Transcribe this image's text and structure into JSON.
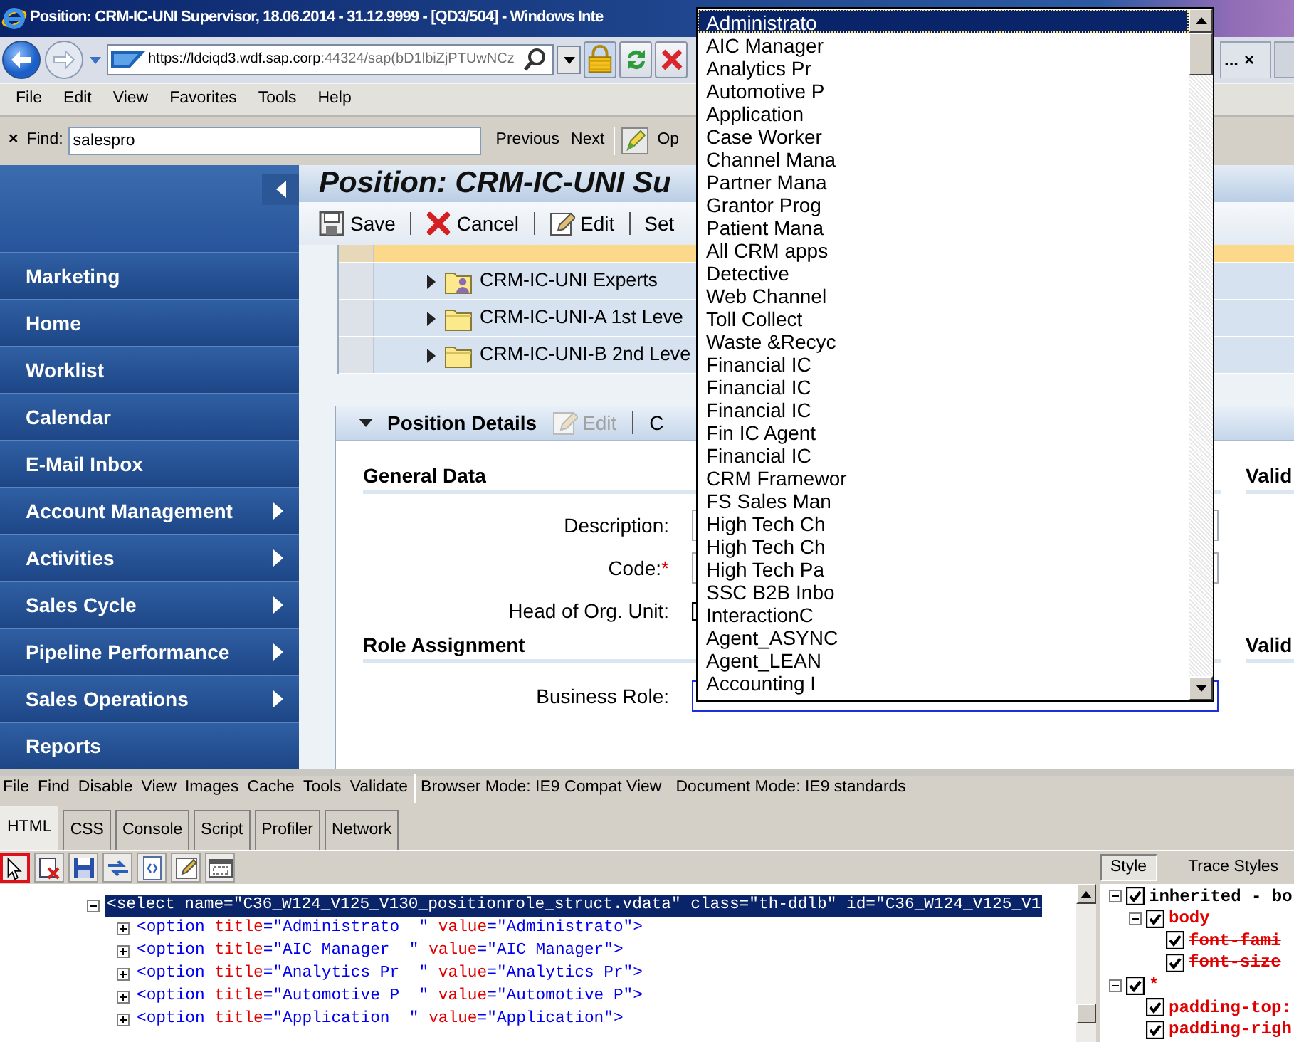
{
  "window": {
    "title": "Position: CRM-IC-UNI Supervisor, 18.06.2014 - 31.12.9999 - [QD3/504] - Windows Inte"
  },
  "address_bar": {
    "host": "https://ldciqd3.wdf.sap.corp",
    "path": ":44324/sap(bD1lbiZjPTUwNCz",
    "tab": {
      "label": "...",
      "close": "×"
    }
  },
  "menu": [
    "File",
    "Edit",
    "View",
    "Favorites",
    "Tools",
    "Help"
  ],
  "find_bar": {
    "close": "×",
    "label": "Find:",
    "value": "salespro",
    "buttons": [
      "Previous",
      "Next"
    ],
    "options": "Op"
  },
  "sidebar": {
    "items": [
      {
        "label": "Marketing",
        "submenu": false
      },
      {
        "label": "Home",
        "submenu": false
      },
      {
        "label": "Worklist",
        "submenu": false
      },
      {
        "label": "Calendar",
        "submenu": false
      },
      {
        "label": "E-Mail Inbox",
        "submenu": false
      },
      {
        "label": "Account Management",
        "submenu": true
      },
      {
        "label": "Activities",
        "submenu": true
      },
      {
        "label": "Sales Cycle",
        "submenu": true
      },
      {
        "label": "Pipeline Performance",
        "submenu": true
      },
      {
        "label": "Sales Operations",
        "submenu": true
      },
      {
        "label": "Reports",
        "submenu": false
      }
    ]
  },
  "page": {
    "title": "Position: CRM-IC-UNI Su",
    "toolbar": [
      {
        "kind": "save",
        "label": "Save"
      },
      {
        "kind": "cancel",
        "label": "Cancel"
      },
      {
        "kind": "edit",
        "label": "Edit"
      },
      {
        "kind": "plain",
        "label": "Set"
      }
    ]
  },
  "tree": {
    "rows": [
      {
        "selected": true
      },
      {
        "label": "CRM-IC-UNI Experts",
        "kind": "group",
        "selected": false
      },
      {
        "label": "CRM-IC-UNI-A 1st Leve",
        "kind": "folder",
        "selected": false
      },
      {
        "label": "CRM-IC-UNI-B 2nd Leve",
        "kind": "folder",
        "selected": false
      }
    ]
  },
  "details": {
    "title": "Position Details",
    "expanded": true,
    "actions": [
      {
        "label": "Edit",
        "disabled": true
      },
      {
        "label": "C",
        "disabled": false
      }
    ],
    "sections": [
      {
        "title": "General Data",
        "side_title": "Valid",
        "fields": [
          {
            "label": "Description:",
            "kind": "text"
          },
          {
            "label": "Code:",
            "kind": "text",
            "marker": "*"
          },
          {
            "label": "Head of Org. Unit:",
            "kind": "checkbox",
            "checked": false
          }
        ]
      },
      {
        "title": "Role Assignment",
        "side_title": "Valid",
        "fields": [
          {
            "label": "Business Role:",
            "kind": "select"
          }
        ]
      }
    ]
  },
  "dropdown": {
    "options": [
      {
        "label": "Administrato",
        "selected": true
      },
      {
        "label": "AIC Manager",
        "selected": false
      },
      {
        "label": "Analytics Pr",
        "selected": false
      },
      {
        "label": "Automotive P",
        "selected": false
      },
      {
        "label": "Application",
        "selected": false
      },
      {
        "label": "Case Worker",
        "selected": false
      },
      {
        "label": "Channel Mana",
        "selected": false
      },
      {
        "label": "Partner Mana",
        "selected": false
      },
      {
        "label": "Grantor Prog",
        "selected": false
      },
      {
        "label": "Patient Mana",
        "selected": false
      },
      {
        "label": "All CRM apps",
        "selected": false
      },
      {
        "label": "Detective",
        "selected": false
      },
      {
        "label": "Web Channel",
        "selected": false
      },
      {
        "label": "Toll Collect",
        "selected": false
      },
      {
        "label": "Waste &Recyc",
        "selected": false
      },
      {
        "label": "Financial IC",
        "selected": false
      },
      {
        "label": "Financial IC",
        "selected": false
      },
      {
        "label": "Financial IC",
        "selected": false
      },
      {
        "label": "Fin IC Agent",
        "selected": false
      },
      {
        "label": "Financial IC",
        "selected": false
      },
      {
        "label": "CRM Framewor",
        "selected": false
      },
      {
        "label": "FS Sales Man",
        "selected": false
      },
      {
        "label": "High Tech Ch",
        "selected": false
      },
      {
        "label": "High Tech Ch",
        "selected": false
      },
      {
        "label": "High Tech Pa",
        "selected": false
      },
      {
        "label": "SSC B2B Inbo",
        "selected": false
      },
      {
        "label": "InteractionC",
        "selected": false
      },
      {
        "label": "Agent_ASYNC",
        "selected": false
      },
      {
        "label": "Agent_LEAN",
        "selected": false
      },
      {
        "label": "Accounting I",
        "selected": false
      }
    ]
  },
  "devtools": {
    "menu": [
      "File",
      "Find",
      "Disable",
      "View",
      "Images",
      "Cache",
      "Tools",
      "Validate"
    ],
    "modes": [
      "Browser Mode: IE9 Compat View",
      "Document Mode: IE9 standards"
    ],
    "tabs": [
      {
        "label": "HTML",
        "selected": true
      },
      {
        "label": "CSS",
        "selected": false
      },
      {
        "label": "Console",
        "selected": false
      },
      {
        "label": "Script",
        "selected": false
      },
      {
        "label": "Profiler",
        "selected": false
      },
      {
        "label": "Network",
        "selected": false
      }
    ],
    "tools": [
      {
        "kind": "pointer",
        "selected": true
      },
      {
        "kind": "clear",
        "selected": false
      },
      {
        "kind": "save",
        "selected": false
      },
      {
        "kind": "refresh",
        "selected": false
      },
      {
        "kind": "source",
        "selected": false
      },
      {
        "kind": "edit",
        "selected": false
      },
      {
        "kind": "outline",
        "selected": false
      }
    ],
    "html_tree": [
      {
        "expanded": true,
        "selected": true,
        "text": "<select name=\"C36_W124_V125_V130_positionrole_struct.vdata\" class=\"th-ddlb\" id=\"C36_W124_V125_V1",
        "children": [
          {
            "expanded": false,
            "selected": false,
            "parts": [
              {
                "kind": "plain",
                "text": "<option "
              },
              {
                "kind": "attr",
                "text": "title"
              },
              {
                "kind": "plain",
                "text": "=\"Administrato  \" "
              },
              {
                "kind": "attr",
                "text": "value"
              },
              {
                "kind": "plain",
                "text": "=\"Administrato\">"
              }
            ]
          },
          {
            "expanded": false,
            "selected": false,
            "parts": [
              {
                "kind": "plain",
                "text": "<option "
              },
              {
                "kind": "attr",
                "text": "title"
              },
              {
                "kind": "plain",
                "text": "=\"AIC Manager  \" "
              },
              {
                "kind": "attr",
                "text": "value"
              },
              {
                "kind": "plain",
                "text": "=\"AIC Manager\">"
              }
            ]
          },
          {
            "expanded": false,
            "selected": false,
            "parts": [
              {
                "kind": "plain",
                "text": "<option "
              },
              {
                "kind": "attr",
                "text": "title"
              },
              {
                "kind": "plain",
                "text": "=\"Analytics Pr  \" "
              },
              {
                "kind": "attr",
                "text": "value"
              },
              {
                "kind": "plain",
                "text": "=\"Analytics Pr\">"
              }
            ]
          },
          {
            "expanded": false,
            "selected": false,
            "parts": [
              {
                "kind": "plain",
                "text": "<option "
              },
              {
                "kind": "attr",
                "text": "title"
              },
              {
                "kind": "plain",
                "text": "=\"Automotive P  \" "
              },
              {
                "kind": "attr",
                "text": "value"
              },
              {
                "kind": "plain",
                "text": "=\"Automotive P\">"
              }
            ]
          },
          {
            "expanded": false,
            "selected": false,
            "parts": [
              {
                "kind": "plain",
                "text": "<option "
              },
              {
                "kind": "attr",
                "text": "title"
              },
              {
                "kind": "plain",
                "text": "=\"Application  \" "
              },
              {
                "kind": "attr",
                "text": "value"
              },
              {
                "kind": "plain",
                "text": "=\"Application\">"
              }
            ]
          }
        ]
      }
    ],
    "style_tabs": [
      {
        "label": "Style",
        "selected": true
      },
      {
        "label": "Trace Styles",
        "selected": false
      }
    ],
    "style_tree": [
      {
        "label": "inherited - bo",
        "kind": "heading",
        "checked": true,
        "expanded": true,
        "children": [
          {
            "label": "body",
            "kind": "rule",
            "checked": true,
            "expanded": true,
            "children": [
              {
                "label": "font-fami",
                "kind": "overridden",
                "checked": true
              },
              {
                "label": "font-size",
                "kind": "overridden",
                "checked": true
              }
            ]
          }
        ]
      },
      {
        "label": "*",
        "kind": "rule",
        "checked": true,
        "expanded": true,
        "children": [
          {
            "label": "padding-top:",
            "kind": "rule",
            "checked": true
          },
          {
            "label": "padding-righ",
            "kind": "rule",
            "checked": true
          }
        ]
      }
    ]
  }
}
